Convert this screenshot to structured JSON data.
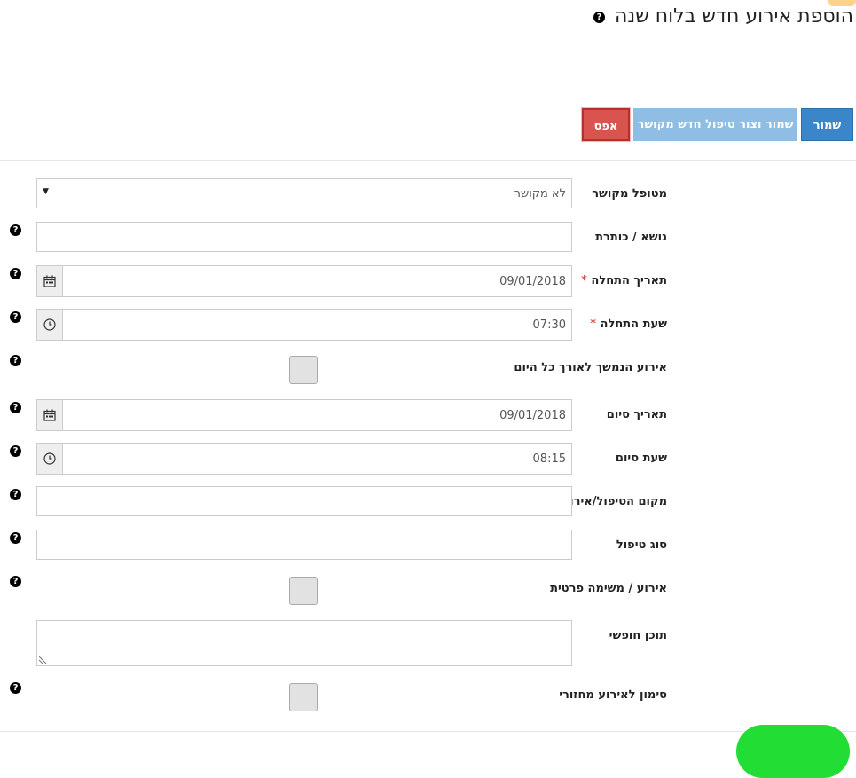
{
  "header": {
    "title": "הוספת אירוע חדש בלוח שנה",
    "help": "?"
  },
  "toolbar": {
    "save_label": "שמור",
    "save_new_label": "שמור וצור טיפול חדש מקושר",
    "reset_label": "אפס"
  },
  "form": {
    "help": "?",
    "required_mark": "*",
    "client": {
      "label": "מטופל מקושר",
      "value": "לא מקושר"
    },
    "subject": {
      "label": "נושא / כותרת",
      "value": ""
    },
    "start_date": {
      "label": "תאריך התחלה",
      "value": "09/01/2018"
    },
    "start_time": {
      "label": "שעת התחלה",
      "value": "07:30"
    },
    "all_day": {
      "label": "אירוע הנמשך לאורך כל היום",
      "checked": false
    },
    "end_date": {
      "label": "תאריך סיום",
      "value": "09/01/2018"
    },
    "end_time": {
      "label": "שעת סיום",
      "value": "08:15"
    },
    "location": {
      "label": "מקום הטיפול/אירוע",
      "value": ""
    },
    "treatment_type": {
      "label": "סוג טיפול",
      "value": ""
    },
    "private": {
      "label": "אירוע / משימה פרטית",
      "checked": false
    },
    "free_text": {
      "label": "תוכן חופשי",
      "value": ""
    },
    "recurring": {
      "label": "סימון לאירוע מחזורי",
      "checked": false
    }
  },
  "icons": {
    "calendar": "calendar-icon",
    "clock": "clock-icon",
    "help": "question-circle-icon"
  },
  "colors": {
    "save": "#3a86c9",
    "save_new": "#8fbde3",
    "reset": "#d9534f",
    "required": "#d9534f",
    "fab": "#22dd33"
  }
}
